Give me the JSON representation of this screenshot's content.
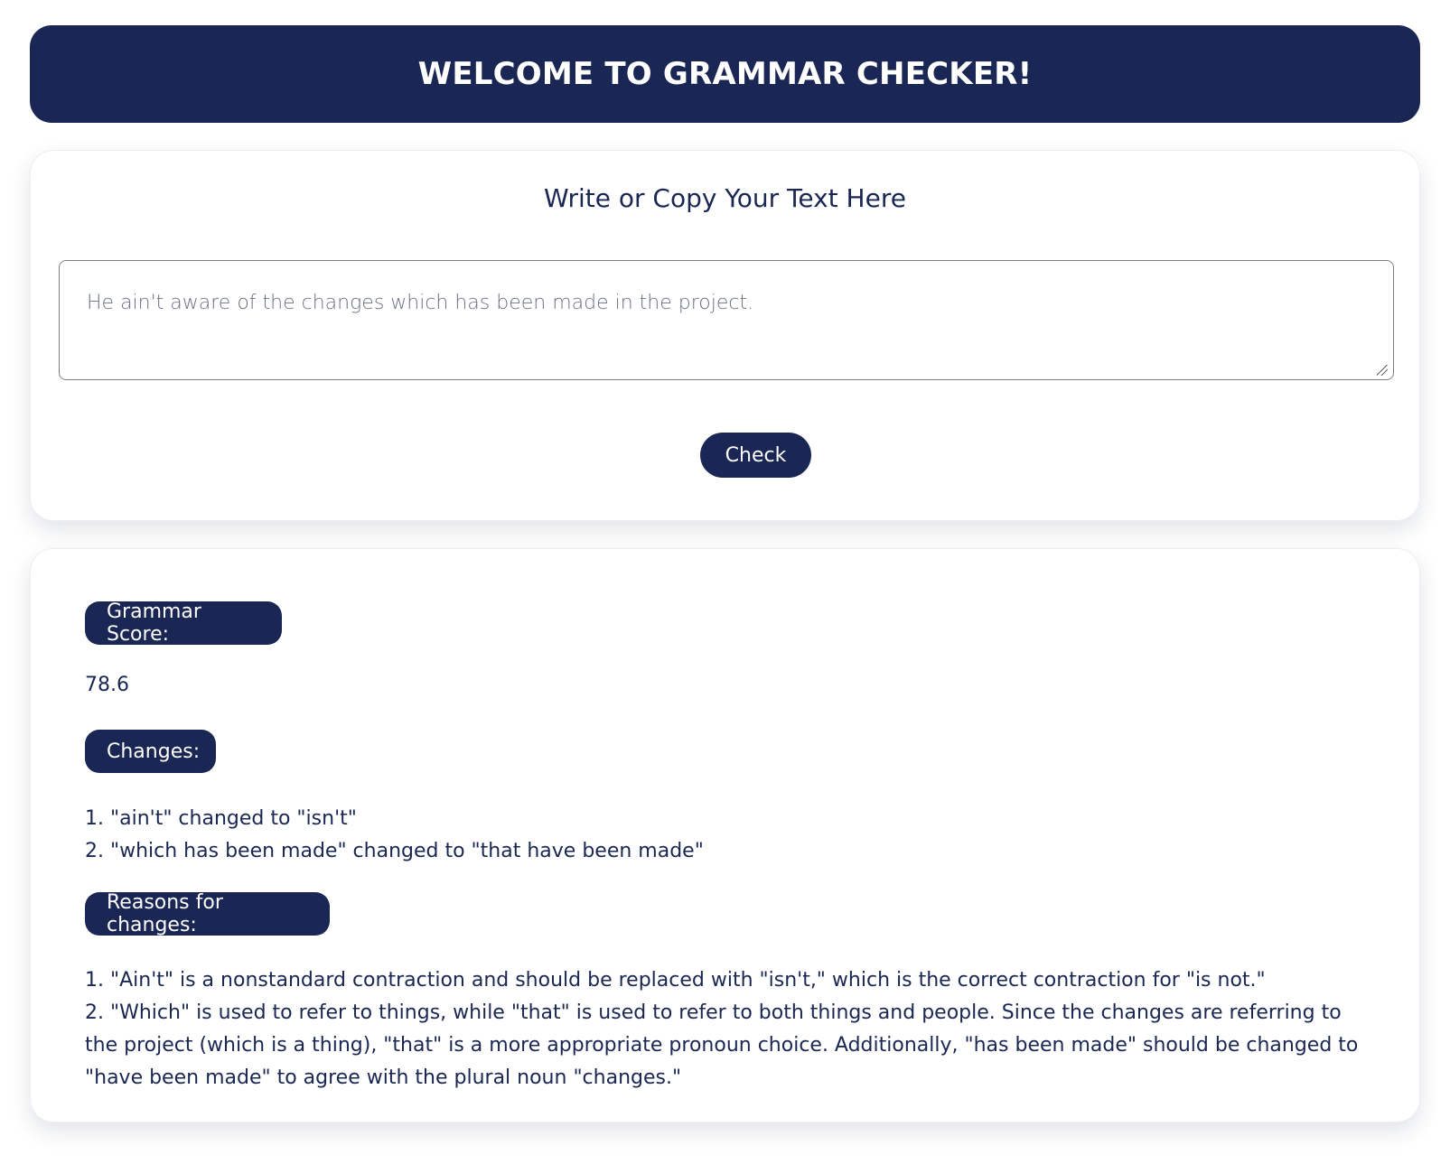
{
  "header": {
    "title": "WELCOME TO GRAMMAR CHECKER!"
  },
  "input_section": {
    "title": "Write or Copy Your Text Here",
    "text_value": "He ain't aware of the changes which has been made in the project.",
    "check_label": "Check"
  },
  "results": {
    "score_label": "Grammar Score:",
    "score_value": "78.6",
    "changes_label": "Changes:",
    "changes": [
      "1. \"ain't\" changed to \"isn't\"",
      "2. \"which has been made\" changed to \"that have been made\""
    ],
    "reasons_label": "Reasons for changes:",
    "reasons": [
      "1. \"Ain't\" is a nonstandard contraction and should be replaced with \"isn't,\" which is the correct contraction for \"is not.\"",
      "2. \"Which\" is used to refer to things, while \"that\" is used to refer to both things and people. Since the changes are referring to the project (which is a thing), \"that\" is a more appropriate pronoun choice. Additionally, \"has been made\" should be changed to \"have been made\" to agree with the plural noun \"changes.\""
    ]
  },
  "colors": {
    "primary": "#1a2653",
    "text": "#1a2753",
    "background": "#ffffff"
  }
}
